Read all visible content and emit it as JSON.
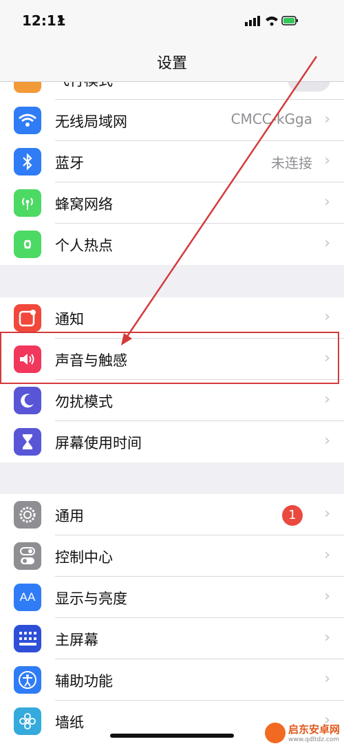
{
  "status": {
    "time": "12:11"
  },
  "nav": {
    "title": "设置"
  },
  "partial_row": {
    "label": "飞行模式"
  },
  "group1": [
    {
      "label": "无线局域网",
      "value": "CMCC-kGga",
      "icon": "wifi-icon",
      "color": "#2f7cf6"
    },
    {
      "label": "蓝牙",
      "value": "未连接",
      "icon": "bluetooth-icon",
      "color": "#2f7cf6"
    },
    {
      "label": "蜂窝网络",
      "value": "",
      "icon": "cellular-icon",
      "color": "#4cd964"
    },
    {
      "label": "个人热点",
      "value": "",
      "icon": "hotspot-icon",
      "color": "#4cd964"
    }
  ],
  "group2": [
    {
      "label": "通知",
      "icon": "notification-icon",
      "color": "#f1483b"
    },
    {
      "label": "声音与触感",
      "icon": "sound-icon",
      "color": "#f1375b"
    },
    {
      "label": "勿扰模式",
      "icon": "moon-icon",
      "color": "#5856d6"
    },
    {
      "label": "屏幕使用时间",
      "icon": "hourglass-icon",
      "color": "#5856d6"
    }
  ],
  "group3": [
    {
      "label": "通用",
      "badge": "1",
      "icon": "gear-icon",
      "color": "#8e8e93"
    },
    {
      "label": "控制中心",
      "icon": "toggles-icon",
      "color": "#8e8e93"
    },
    {
      "label": "显示与亮度",
      "icon": "display-icon",
      "color": "#2f7cf6"
    },
    {
      "label": "主屏幕",
      "icon": "home-screen-icon",
      "color": "#2d4fd8"
    },
    {
      "label": "辅助功能",
      "icon": "accessibility-icon",
      "color": "#2f7cf6"
    },
    {
      "label": "墙纸",
      "icon": "wallpaper-icon",
      "color": "#35aadc"
    }
  ],
  "chevron": "›",
  "watermark": {
    "title": "启东安卓网",
    "url": "www.qdltdz.com"
  }
}
